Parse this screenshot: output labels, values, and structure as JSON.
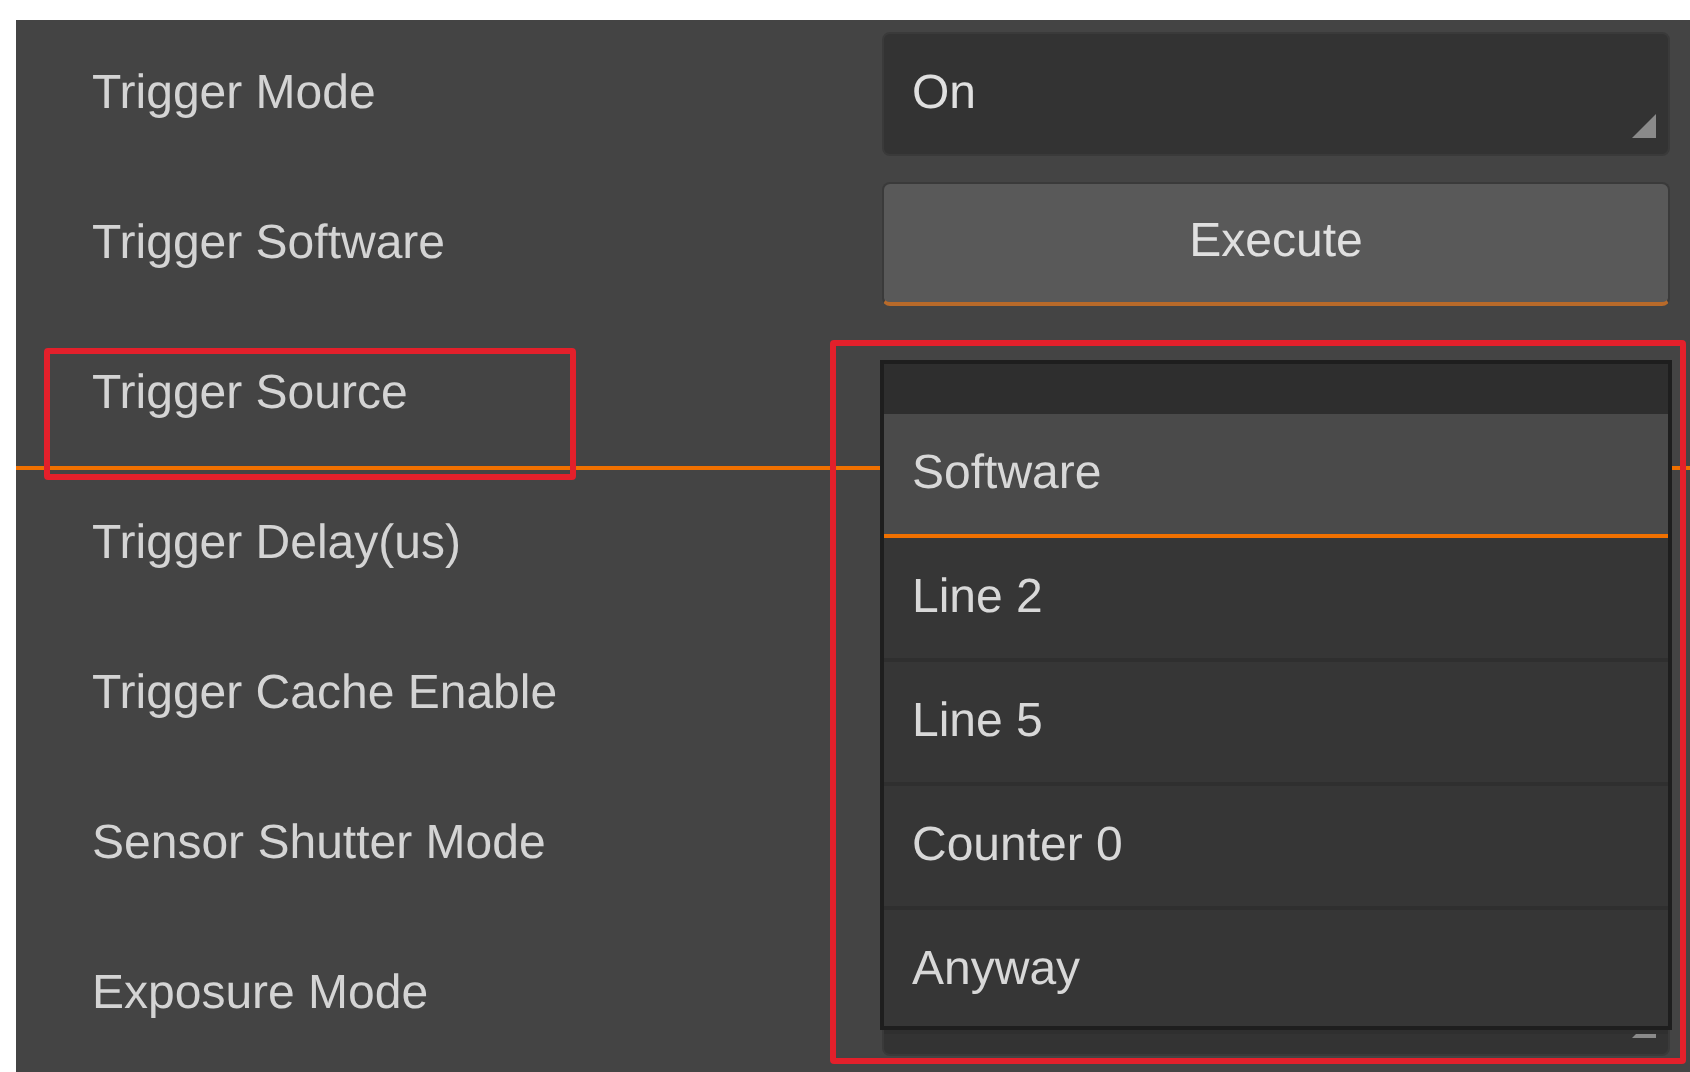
{
  "rows": [
    {
      "label": "Trigger Mode",
      "selected": false,
      "highlighted": false,
      "control": {
        "kind": "combo",
        "value": "On"
      }
    },
    {
      "label": "Trigger Software",
      "selected": false,
      "highlighted": false,
      "control": {
        "kind": "button",
        "value": "Execute"
      }
    },
    {
      "label": "Trigger Source",
      "selected": true,
      "highlighted": true,
      "control": {
        "kind": "none"
      }
    },
    {
      "label": "Trigger Delay(us)",
      "selected": false,
      "highlighted": false,
      "control": {
        "kind": "none"
      }
    },
    {
      "label": "Trigger Cache Enable",
      "selected": false,
      "highlighted": false,
      "control": {
        "kind": "none"
      }
    },
    {
      "label": "Sensor Shutter Mode",
      "selected": false,
      "highlighted": false,
      "control": {
        "kind": "none"
      }
    },
    {
      "label": "Exposure Mode",
      "selected": false,
      "highlighted": false,
      "control": {
        "kind": "combo"
      }
    }
  ],
  "dropdown": {
    "highlighted": true,
    "options": [
      {
        "label": "Software",
        "selected": true
      },
      {
        "label": "Line 2",
        "selected": false
      },
      {
        "label": "Line 5",
        "selected": false
      },
      {
        "label": "Counter 0",
        "selected": false
      },
      {
        "label": "Anyway",
        "selected": false
      }
    ]
  }
}
